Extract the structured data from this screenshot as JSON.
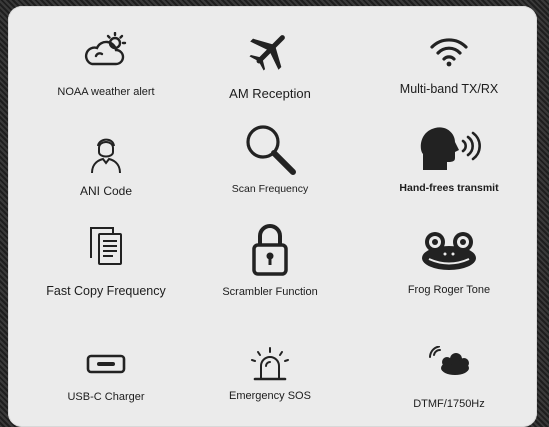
{
  "features": [
    {
      "label": "NOAA weather alert",
      "icon": "weather-cloud-sun-icon"
    },
    {
      "label": "AM Reception",
      "icon": "airplane-icon"
    },
    {
      "label": "Multi-band TX/RX",
      "icon": "wifi-signal-icon"
    },
    {
      "label": "ANI Code",
      "icon": "person-avatar-icon"
    },
    {
      "label": "Scan Frequency",
      "icon": "magnifier-icon"
    },
    {
      "label": "Hand-frees transmit",
      "icon": "speaking-head-icon"
    },
    {
      "label": "Fast Copy Frequency",
      "icon": "copy-documents-icon"
    },
    {
      "label": "Scrambler Function",
      "icon": "padlock-icon"
    },
    {
      "label": "Frog Roger Tone",
      "icon": "frog-face-icon"
    },
    {
      "label": "USB-C Charger",
      "icon": "usb-c-port-icon"
    },
    {
      "label": "Emergency SOS",
      "icon": "siren-light-icon"
    },
    {
      "label": "DTMF/1750Hz",
      "icon": "keypad-tone-icon"
    }
  ],
  "colors": {
    "panel": "#ebebeb",
    "icon": "#222222",
    "text": "#1c1c1c"
  }
}
